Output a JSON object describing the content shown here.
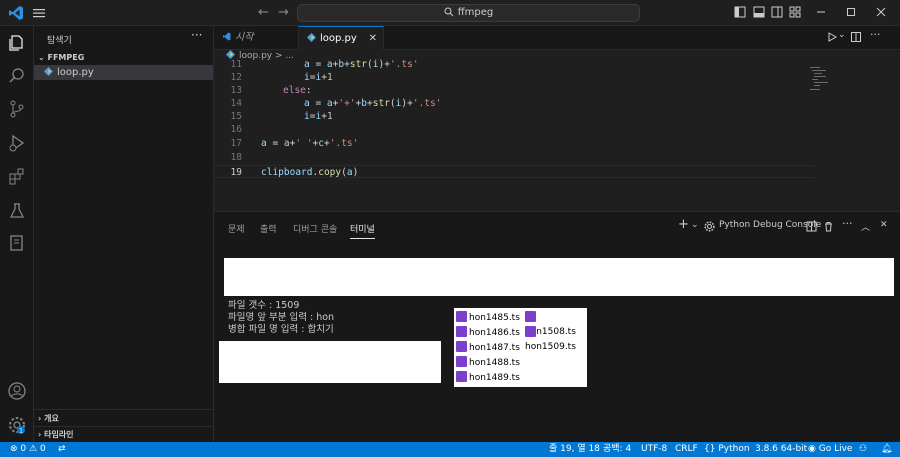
{
  "titlebar": {
    "search_text": "ffmpeg"
  },
  "sidebar": {
    "title": "탐색기",
    "folder": "FFMPEG",
    "file": "loop.py",
    "outline_section": "개요",
    "timeline_section": "타임라인"
  },
  "tabs": [
    {
      "label": "시작"
    },
    {
      "label": "loop.py"
    }
  ],
  "breadcrumb": "loop.py > ...",
  "editor": {
    "lines": [
      {
        "num": "11",
        "text": "a = a+b+str(i)+'.ts'"
      },
      {
        "num": "12",
        "text": "i=i+1"
      },
      {
        "num": "13",
        "text": "else:"
      },
      {
        "num": "14",
        "text": "a = a+'+'+b+str(i)+'.ts'"
      },
      {
        "num": "15",
        "text": "i=i+1"
      },
      {
        "num": "16",
        "text": ""
      },
      {
        "num": "17",
        "text": "a = a+' '+c+'.ts'"
      },
      {
        "num": "18",
        "text": ""
      },
      {
        "num": "19",
        "text": "clipboard.copy(a)"
      }
    ]
  },
  "panel": {
    "tabs": [
      "문제",
      "출력",
      "디버그 콘솔",
      "터미널"
    ],
    "active_tab": "터미널",
    "terminal_name": "Python Debug Console",
    "terminal_lines": [
      "파일 갯수 : 1509",
      "파일명 앞 부분 입력 : hon",
      "병합 파일 명 입력 : 합치기"
    ]
  },
  "file_popup": {
    "col1": [
      "hon1485.ts",
      "hon1486.ts",
      "hon1487.ts",
      "hon1488.ts",
      "hon1489.ts"
    ],
    "col2": [
      "hon1508.ts",
      "hon1509.ts"
    ]
  },
  "statusbar": {
    "errors": "0",
    "warnings": "0",
    "position": "줄 19, 열 18",
    "spaces": "공백: 4",
    "encoding": "UTF-8",
    "eol": "CRLF",
    "language": "Python",
    "interpreter": "3.8.6 64-bit",
    "golive": "Go Live",
    "bell_badge": "1"
  },
  "colors": {
    "accent": "#0078d4",
    "status_bg": "#0078d4"
  }
}
